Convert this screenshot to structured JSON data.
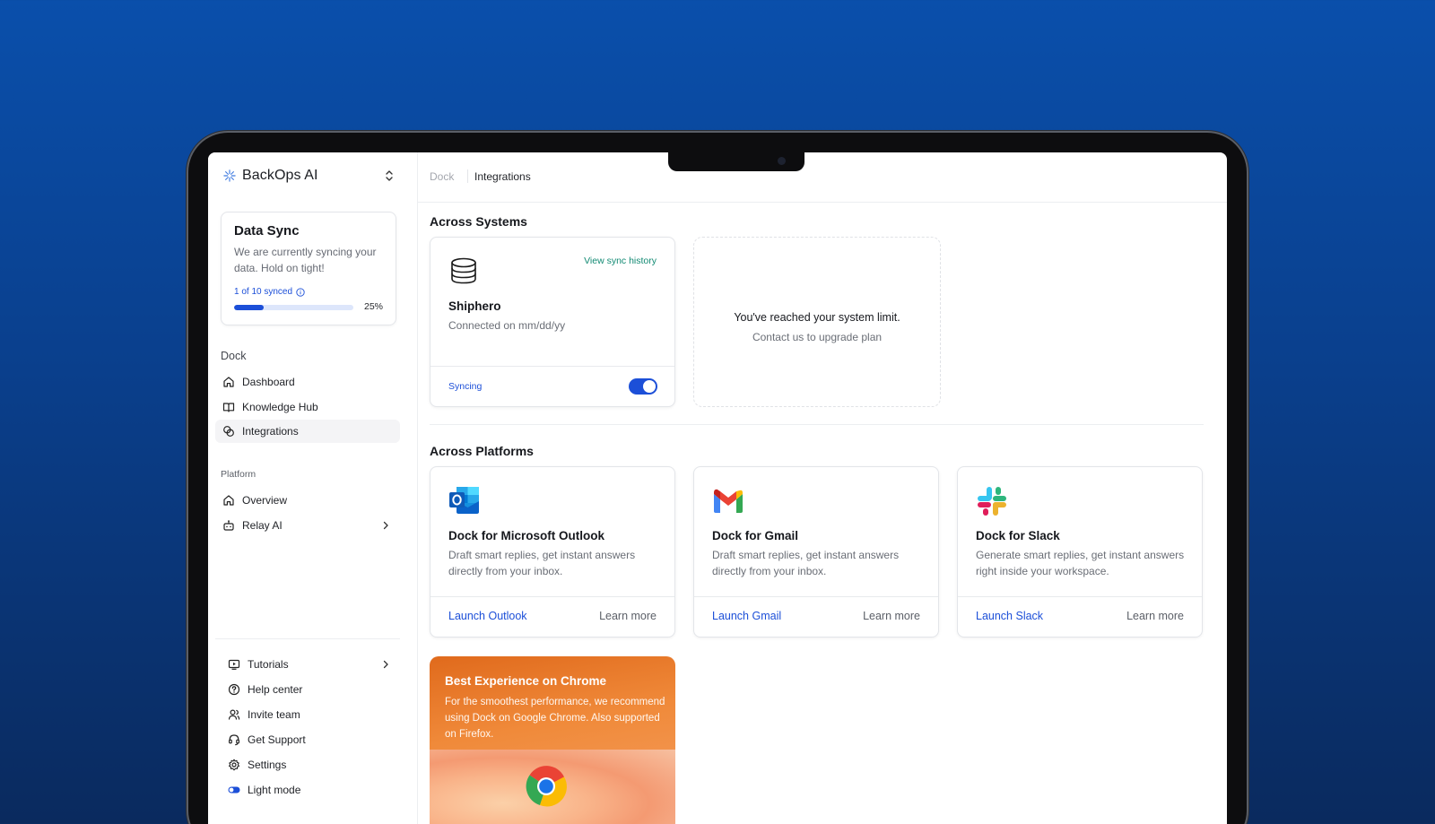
{
  "app": {
    "name": "BackOps AI"
  },
  "sync_card": {
    "title": "Data Sync",
    "description": "We are currently syncing your data. Hold on tight!",
    "count_text": "1 of 10 synced",
    "progress": 0.25,
    "percent_text": "25%"
  },
  "sidebar": {
    "dock_heading": "Dock",
    "dock_items": [
      {
        "label": "Dashboard",
        "icon": "home-icon"
      },
      {
        "label": "Knowledge Hub",
        "icon": "book-icon"
      },
      {
        "label": "Integrations",
        "icon": "link-icon",
        "active": true
      }
    ],
    "platform_heading": "Platform",
    "platform_items": [
      {
        "label": "Overview",
        "icon": "home-icon"
      },
      {
        "label": "Relay AI",
        "icon": "bot-icon"
      }
    ],
    "bottom_items": [
      {
        "label": "Tutorials",
        "icon": "video-icon"
      },
      {
        "label": "Help center",
        "icon": "help-icon"
      },
      {
        "label": "Invite team",
        "icon": "users-icon"
      },
      {
        "label": "Get Support",
        "icon": "headset-icon"
      },
      {
        "label": "Settings",
        "icon": "gear-icon"
      },
      {
        "label": "Light mode",
        "icon": "toggle-icon"
      }
    ]
  },
  "breadcrumb": {
    "parent": "Dock",
    "current": "Integrations"
  },
  "systems": {
    "title": "Across Systems",
    "shiphero": {
      "name": "Shiphero",
      "connected": "Connected on mm/dd/yy",
      "history_link": "View sync history",
      "status": "Syncing",
      "enabled": true
    },
    "limit": {
      "title": "You've reached your system limit.",
      "subtitle": "Contact us to upgrade plan"
    }
  },
  "platforms": {
    "title": "Across Platforms",
    "cards": [
      {
        "name": "Dock for Microsoft Outlook",
        "description": "Draft smart replies, get instant answers directly from your inbox.",
        "launch": "Launch Outlook",
        "learn": "Learn more",
        "icon": "outlook-icon"
      },
      {
        "name": "Dock for Gmail",
        "description": "Draft smart replies, get instant answers directly from your inbox.",
        "launch": "Launch Gmail",
        "learn": "Learn more",
        "icon": "gmail-icon"
      },
      {
        "name": "Dock for Slack",
        "description": "Generate smart replies, get instant answers right inside your workspace.",
        "launch": "Launch Slack",
        "learn": "Learn more",
        "icon": "slack-icon"
      }
    ]
  },
  "chrome_banner": {
    "title": "Best Experience on Chrome",
    "description": "For the smoothest performance, we recommend using Dock on Google Chrome. Also supported on Firefox.",
    "icon": "chrome-icon"
  },
  "colors": {
    "accent": "#1c4fd8",
    "background_top": "#0a4fab",
    "background_bottom": "#0a2a5e"
  }
}
